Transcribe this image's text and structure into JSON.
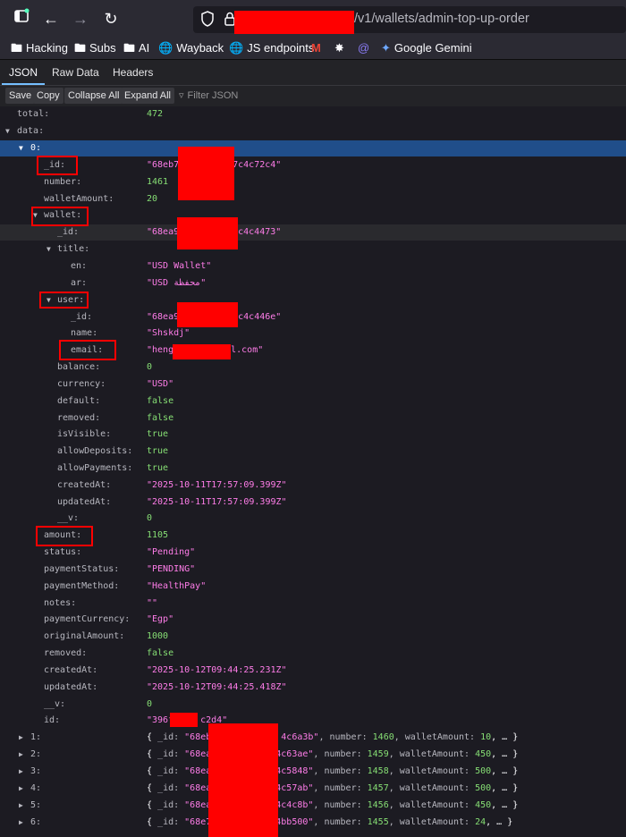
{
  "browser": {
    "url_tail": "/v1/wallets/admin-top-up-order",
    "bookmarks": [
      "Hacking",
      "Subs",
      "AI",
      "Wayback",
      "JS endpoints",
      "Google Gemini"
    ]
  },
  "viewer": {
    "tabs": [
      "JSON",
      "Raw Data",
      "Headers"
    ],
    "toolbar": {
      "save": "Save",
      "copy": "Copy",
      "collapse": "Collapse All",
      "expand": "Expand All",
      "filter_placeholder": "Filter JSON"
    }
  },
  "json": {
    "total": {
      "k": "total:",
      "v": "472"
    },
    "data": {
      "k": "data:"
    },
    "item0": {
      "k": "0:",
      "_id": {
        "k": "_id:",
        "v": "\"68eb7",
        "v2": "7c4c72c4\""
      },
      "number": {
        "k": "number:",
        "v": "1461"
      },
      "walletAmount": {
        "k": "walletAmount:",
        "v": "20"
      },
      "wallet": {
        "k": "wallet:",
        "_id": {
          "k": "_id:",
          "v": "\"68ea9",
          "v2": "c4c4473\""
        },
        "title": {
          "k": "title:",
          "en": {
            "k": "en:",
            "v": "\"USD Wallet\""
          },
          "ar": {
            "k": "ar:",
            "v": "\"USD محفظة\""
          }
        },
        "user": {
          "k": "user:",
          "_id": {
            "k": "_id:",
            "v": "\"68ea9",
            "v2": "7c4c446e\""
          },
          "name": {
            "k": "name:",
            "v": "\"Shskdj\""
          },
          "email": {
            "k": "email:",
            "v": "\"heng",
            "v2": "l.com\""
          }
        },
        "balance": {
          "k": "balance:",
          "v": "0"
        },
        "currency": {
          "k": "currency:",
          "v": "\"USD\""
        },
        "default": {
          "k": "default:",
          "v": "false"
        },
        "removed": {
          "k": "removed:",
          "v": "false"
        },
        "isVisible": {
          "k": "isVisible:",
          "v": "true"
        },
        "allowDeposits": {
          "k": "allowDeposits:",
          "v": "true"
        },
        "allowPayments": {
          "k": "allowPayments:",
          "v": "true"
        },
        "createdAt": {
          "k": "createdAt:",
          "v": "\"2025-10-11T17:57:09.399Z\""
        },
        "updatedAt": {
          "k": "updatedAt:",
          "v": "\"2025-10-11T17:57:09.399Z\""
        },
        "__v": {
          "k": "__v:",
          "v": "0"
        }
      },
      "amount": {
        "k": "amount:",
        "v": "1105"
      },
      "status": {
        "k": "status:",
        "v": "\"Pending\""
      },
      "paymentStatus": {
        "k": "paymentStatus:",
        "v": "\"PENDING\""
      },
      "paymentMethod": {
        "k": "paymentMethod:",
        "v": "\"HealthPay\""
      },
      "notes": {
        "k": "notes:",
        "v": "\"\""
      },
      "paymentCurrency": {
        "k": "paymentCurrency:",
        "v": "\"Egp\""
      },
      "originalAmount": {
        "k": "originalAmount:",
        "v": "1000"
      },
      "removed": {
        "k": "removed:",
        "v": "false"
      },
      "createdAt": {
        "k": "createdAt:",
        "v": "\"2025-10-12T09:44:25.231Z\""
      },
      "updatedAt": {
        "k": "updatedAt:",
        "v": "\"2025-10-12T09:44:25.418Z\""
      },
      "__v": {
        "k": "__v:",
        "v": "0"
      },
      "id": {
        "k": "id:",
        "v": "\"396f",
        "v2": "c2d4\""
      }
    },
    "collapsed": [
      {
        "k": "1:",
        "id_a": "\"68eb3",
        "id_b": "4c6a3b\"",
        "number": "1460",
        "walletAmount": "10"
      },
      {
        "k": "2:",
        "id_a": "\"68ea",
        "id_b": "4c63ae\"",
        "number": "1459",
        "walletAmount": "450"
      },
      {
        "k": "3:",
        "id_a": "\"68ea",
        "id_b": "4c5848\"",
        "number": "1458",
        "walletAmount": "500"
      },
      {
        "k": "4:",
        "id_a": "\"68ea",
        "id_b": "4c57ab\"",
        "number": "1457",
        "walletAmount": "500"
      },
      {
        "k": "5:",
        "id_a": "\"68ea",
        "id_b": "4c4c8b\"",
        "number": "1456",
        "walletAmount": "450"
      },
      {
        "k": "6:",
        "id_a": "\"68e7",
        "id_b": "4bb500\"",
        "number": "1455",
        "walletAmount": "24"
      }
    ],
    "collapsed_labels": {
      "open": "{ ",
      "id_key": "_id: ",
      "number_key": ", number: ",
      "wallet_key": ", walletAmount: ",
      "tail": ", … }"
    }
  }
}
